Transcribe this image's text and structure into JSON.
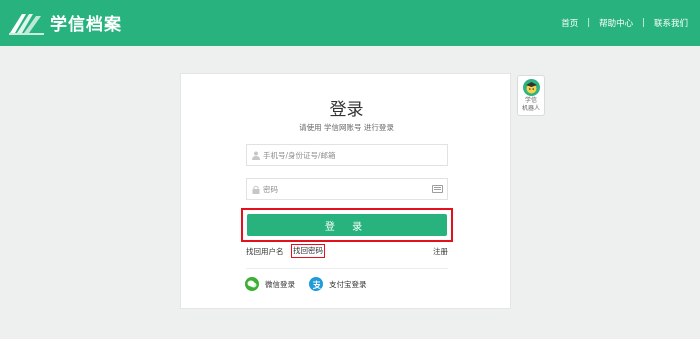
{
  "header": {
    "brand": "学信档案",
    "nav": [
      {
        "label": "首页"
      },
      {
        "label": "帮助中心"
      },
      {
        "label": "联系我们"
      }
    ],
    "separator": "|",
    "bg_color": "#28b37e"
  },
  "login": {
    "title": "登录",
    "subtitle": "请使用 学信网账号 进行登录",
    "username_placeholder": "手机号/身份证号/邮箱",
    "password_placeholder": "密码",
    "submit_label": "登 录",
    "find_username": "找回用户名",
    "find_password": "找回密码",
    "register": "注册",
    "wechat_login": "微信登录",
    "alipay_login": "支付宝登录",
    "accent_color": "#28b37e",
    "highlight_color": "#e3111b"
  },
  "robot": {
    "label_line1": "学信",
    "label_line2": "机器人"
  }
}
